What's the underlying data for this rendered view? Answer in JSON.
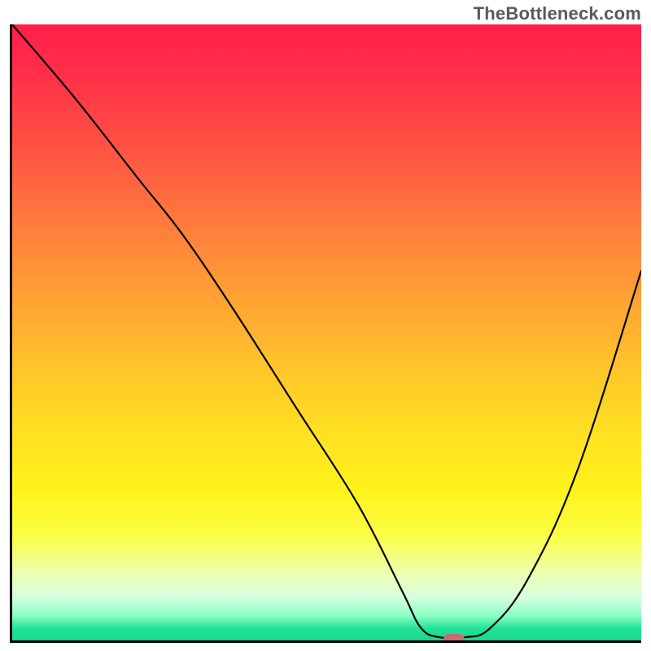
{
  "watermark": {
    "text": "TheBottleneck.com"
  },
  "colors": {
    "axis": "#000000",
    "curve": "#000000",
    "marker": "#c76d6d",
    "gradient_top": "#ff1f4a",
    "gradient_bottom": "#18d68e"
  },
  "chart_data": {
    "type": "line",
    "title": "",
    "xlabel": "",
    "ylabel": "",
    "xlim": [
      0,
      100
    ],
    "ylim": [
      0,
      100
    ],
    "grid": false,
    "legend": false,
    "background": "red-yellow-green vertical gradient",
    "series": [
      {
        "name": "bottleneck-curve",
        "x": [
          0,
          10,
          20,
          27,
          35,
          45,
          55,
          62,
          65,
          68,
          72,
          76,
          82,
          90,
          100
        ],
        "y": [
          100,
          88,
          75,
          66,
          54,
          38,
          22,
          8,
          2,
          0.5,
          0.5,
          2,
          10,
          28,
          60
        ]
      }
    ],
    "annotations": [
      {
        "name": "optimal-marker",
        "x": 70,
        "y": 0.5,
        "shape": "pill",
        "color": "#c76d6d"
      }
    ]
  }
}
